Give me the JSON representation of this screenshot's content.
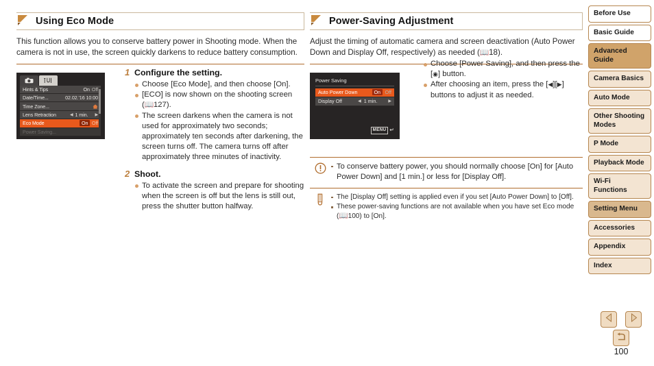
{
  "page": {
    "number": "100"
  },
  "left_section": {
    "heading": "Using Eco Mode",
    "intro": "This function allows you to conserve battery power in Shooting mode. When the camera is not in use, the screen quickly darkens to reduce battery consumption.",
    "camera_screen": {
      "tabs": [
        "camera-icon",
        "wrench-tools-icon"
      ],
      "rows": [
        {
          "label": "Hints & Tips",
          "value": "On",
          "value2": "Off",
          "type": "onoff_plain"
        },
        {
          "label": "Date/Time...",
          "value": "02.02.'16 10:00",
          "type": "text"
        },
        {
          "label": "Time Zone...",
          "value": "home-icon",
          "type": "icon"
        },
        {
          "label": "Lens Retraction",
          "value": "1 min.",
          "type": "stepper"
        },
        {
          "label": "Eco Mode",
          "value": "On",
          "value2": "Off",
          "type": "selected_onoff"
        },
        {
          "label": "Power Saving...",
          "value": "",
          "type": "disabled"
        }
      ]
    },
    "steps": [
      {
        "number": "1",
        "title": "Configure the setting.",
        "bullets": [
          "Choose [Eco Mode], and then choose [On].",
          "[ECO] is now shown on the shooting screen ( 127).",
          "The screen darkens when the camera is not used for approximately two seconds; approximately ten seconds after darkening, the screen turns off. The camera turns off after approximately three minutes of inactivity."
        ],
        "bullet_refs": [
          "",
          "127",
          ""
        ]
      },
      {
        "number": "2",
        "title": "Shoot.",
        "bullets": [
          "To activate the screen and prepare for shooting when the screen is off but the lens is still out, press the shutter button halfway."
        ],
        "bullet_refs": [
          ""
        ]
      }
    ]
  },
  "right_section": {
    "heading": "Power-Saving Adjustment",
    "intro_before": "Adjust the timing of automatic camera and screen deactivation (Auto Power Down and Display Off, respectively) as needed (",
    "intro_ref": "18",
    "intro_after": ").",
    "camera_screen": {
      "title": "Power Saving",
      "rows": [
        {
          "label": "Auto Power Down",
          "value": "On",
          "value2": "Off",
          "type": "selected_onoff"
        },
        {
          "label": "Display Off",
          "value": "1 min.",
          "type": "stepper"
        }
      ],
      "menu_button": "MENU",
      "menu_return_glyph": "return-arrow-icon"
    },
    "bullets": [
      "Choose [Power Saving], and then press the [ ] button.",
      "After choosing an item, press the [◀][▶] buttons to adjust it as needed."
    ],
    "bullet1_pre": "Choose [Power Saving], and then press the [",
    "bullet1_post": "] button.",
    "bullet2_pre": "After choosing an item, press the [",
    "bullet2_mid": "][",
    "bullet2_post": "] buttons to adjust it as needed.",
    "warning_note": {
      "icon": "exclamation-circle-icon",
      "items": [
        "To conserve battery power, you should normally choose [On] for [Auto Power Down] and [1 min.] or less for [Display Off]."
      ]
    },
    "tip_note": {
      "icon": "pencil-icon",
      "items": [
        "The [Display Off] setting is applied even if you set [Auto Power Down] to [Off].",
        "These power-saving functions are not available when you have set Eco mode ( 100) to [On]."
      ],
      "item2_pre": "These power-saving functions are not available when you have set Eco mode (",
      "item2_ref": "100",
      "item2_post": ") to [On]."
    }
  },
  "sidebar": {
    "items": [
      {
        "label": "Before Use",
        "level": "l1"
      },
      {
        "label": "Basic Guide",
        "level": "l1"
      },
      {
        "label": "Advanced Guide",
        "level": "l1sel"
      },
      {
        "label": "Camera Basics",
        "level": "l2"
      },
      {
        "label": "Auto Mode",
        "level": "l2"
      },
      {
        "label": "Other Shooting Modes",
        "level": "l2"
      },
      {
        "label": "P Mode",
        "level": "l2"
      },
      {
        "label": "Playback Mode",
        "level": "l2"
      },
      {
        "label": "Wi-Fi Functions",
        "level": "l2"
      },
      {
        "label": "Setting Menu",
        "level": "l2sel"
      },
      {
        "label": "Accessories",
        "level": "l2"
      },
      {
        "label": "Appendix",
        "level": "l2"
      },
      {
        "label": "Index",
        "level": "l2"
      }
    ]
  },
  "pagenav": {
    "prev": "prev-page-icon",
    "next": "next-page-icon",
    "home": "return-home-icon"
  },
  "colors": {
    "accent": "#b06c2c",
    "nav_border": "#b5854e",
    "nav_selected": "#d0a36a",
    "nav_sub": "#f3e4d2",
    "nav_sub_selected": "#d9b88e",
    "menu_highlight": "#e8591c",
    "bullet": "#d8a06a",
    "step_number": "#bc7f3e"
  }
}
